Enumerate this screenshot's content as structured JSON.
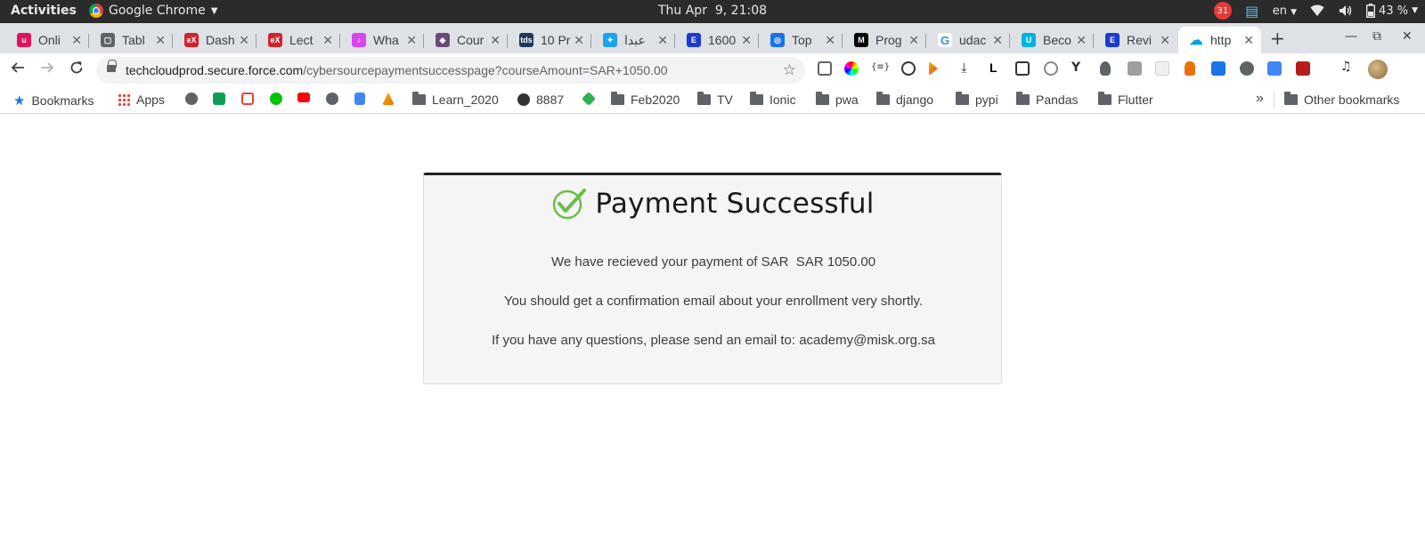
{
  "system_bar": {
    "activities": "Activities",
    "app_name": "Google Chrome",
    "clock": "Thu Apr  9, 21:08",
    "calendar_badge": "31",
    "lang": "en",
    "battery": "43 %"
  },
  "tabs": [
    {
      "title": "Onli",
      "favicon_color": "#e0115f",
      "favicon_glyph": "u"
    },
    {
      "title": "Tabl",
      "favicon_color": "#5f6368",
      "favicon_glyph": "▢"
    },
    {
      "title": "Dash",
      "favicon_color": "#d2232a",
      "favicon_glyph": "eX"
    },
    {
      "title": "Lect",
      "favicon_color": "#d2232a",
      "favicon_glyph": "eX"
    },
    {
      "title": "Wha",
      "favicon_color": "#d946ef",
      "favicon_glyph": "♪"
    },
    {
      "title": "Cour",
      "favicon_color": "#6b4a7a",
      "favicon_glyph": "◆"
    },
    {
      "title": "10 Pr",
      "favicon_color": "#1d3a5c",
      "favicon_glyph": "tds"
    },
    {
      "title": "عبدا",
      "favicon_color": "#1da1f2",
      "favicon_glyph": "✦"
    },
    {
      "title": "1600",
      "favicon_color": "#1a3cd1",
      "favicon_glyph": "E"
    },
    {
      "title": "Top",
      "favicon_color": "#1a73e8",
      "favicon_glyph": "◎"
    },
    {
      "title": "Prog",
      "favicon_color": "#000000",
      "favicon_glyph": "M"
    },
    {
      "title": "udac",
      "favicon_color": "#ffffff",
      "favicon_glyph": "G"
    },
    {
      "title": "Beco",
      "favicon_color": "#02b3e4",
      "favicon_glyph": "U"
    },
    {
      "title": "Revi",
      "favicon_color": "#1a3cd1",
      "favicon_glyph": "E"
    },
    {
      "title": "http",
      "favicon_color": "#00a1e0",
      "favicon_glyph": "☁",
      "active": true
    }
  ],
  "omnibox": {
    "host": "techcloudprod.secure.force.com",
    "path": "/cybersourcepaymentsuccesspage?courseAmount=SAR+1050.00"
  },
  "bookmarks": {
    "bookmarks_label": "Bookmarks",
    "apps_label": "Apps",
    "folders": [
      "Learn_2020",
      "8887",
      "Feb2020",
      "TV",
      "Ionic",
      "pwa",
      "django",
      "pypi",
      "Pandas",
      "Flutter"
    ],
    "more": "»",
    "other": "Other bookmarks"
  },
  "page": {
    "title": "Payment Successful",
    "line1": "We have recieved your payment of SAR  SAR 1050.00",
    "line2": "You should get a confirmation email about your enrollment very shortly.",
    "line3": "If you have any questions, please send an email to: academy@misk.org.sa",
    "accent_color": "#6cbd45"
  }
}
